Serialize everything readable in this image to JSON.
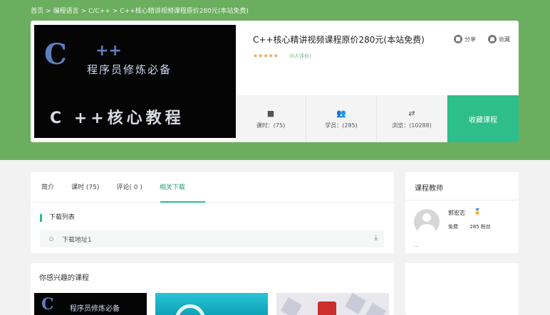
{
  "breadcrumb": [
    "首页",
    ">",
    "编程语言",
    ">",
    "C/C++",
    ">",
    "C++核心精讲视频课程原价280元(本站免费)"
  ],
  "course": {
    "cover_logo_c": "C",
    "cover_logo_plus": "++",
    "cover_logo_sub": "程序员修炼必备",
    "cover_big": "C ++核心教程",
    "title": "C++核心精讲视频课程原价280元(本站免费)",
    "stars": "★★★★★",
    "rating_count": "(0人评价)",
    "share_label": "分享",
    "fav_label": "收藏"
  },
  "stats": [
    {
      "icon": "video-camera-icon",
      "glyph": "■",
      "label": "课时：(75)"
    },
    {
      "icon": "users-icon",
      "glyph": "👥",
      "label": "学员：(285)"
    },
    {
      "icon": "arrows-icon",
      "glyph": "⇄",
      "label": "浏览：(10288)"
    }
  ],
  "collect_button": "收藏课程",
  "tabs": [
    "简介",
    "课时 (75)",
    "评论( 0 )",
    "相关下载"
  ],
  "active_tab": 3,
  "downloads": {
    "heading": "下载列表",
    "items": [
      "下载地址1"
    ]
  },
  "teacher": {
    "section_title": "课程教师",
    "name": "郭宏志",
    "badge": "🏅",
    "price": "免费",
    "fans": "285 粉丝",
    "more": "..."
  },
  "interest": {
    "title": "你感兴趣的课程"
  },
  "colors": {
    "accent": "#2dbe8b",
    "hero_bg": "#6bae5f"
  }
}
